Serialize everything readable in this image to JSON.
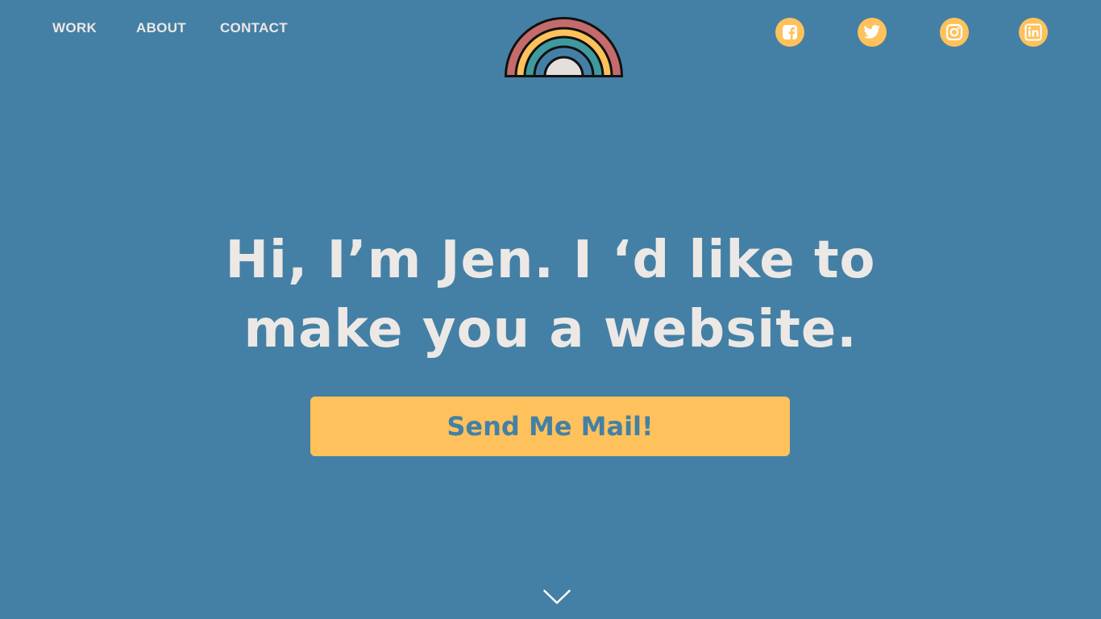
{
  "nav": {
    "items": [
      {
        "label": "WORK"
      },
      {
        "label": "ABOUT"
      },
      {
        "label": "CONTACT"
      }
    ]
  },
  "logo": {
    "icon": "rainbow-icon",
    "colors": [
      "#c56b6b",
      "#fec15b",
      "#3f9aa0",
      "#4480a5",
      "#e3dfdc"
    ]
  },
  "social": [
    {
      "icon": "facebook-icon"
    },
    {
      "icon": "twitter-icon"
    },
    {
      "icon": "instagram-icon"
    },
    {
      "icon": "linkedin-icon"
    }
  ],
  "hero": {
    "line1": "Hi, I’m Jen. I ‘d like to",
    "line2": "make you a website.",
    "cta_label": "Send Me Mail!"
  },
  "scroll": {
    "icon": "chevron-down-icon"
  },
  "colors": {
    "background": "#4480a5",
    "accent": "#fec15b",
    "text": "#ece8e5"
  }
}
